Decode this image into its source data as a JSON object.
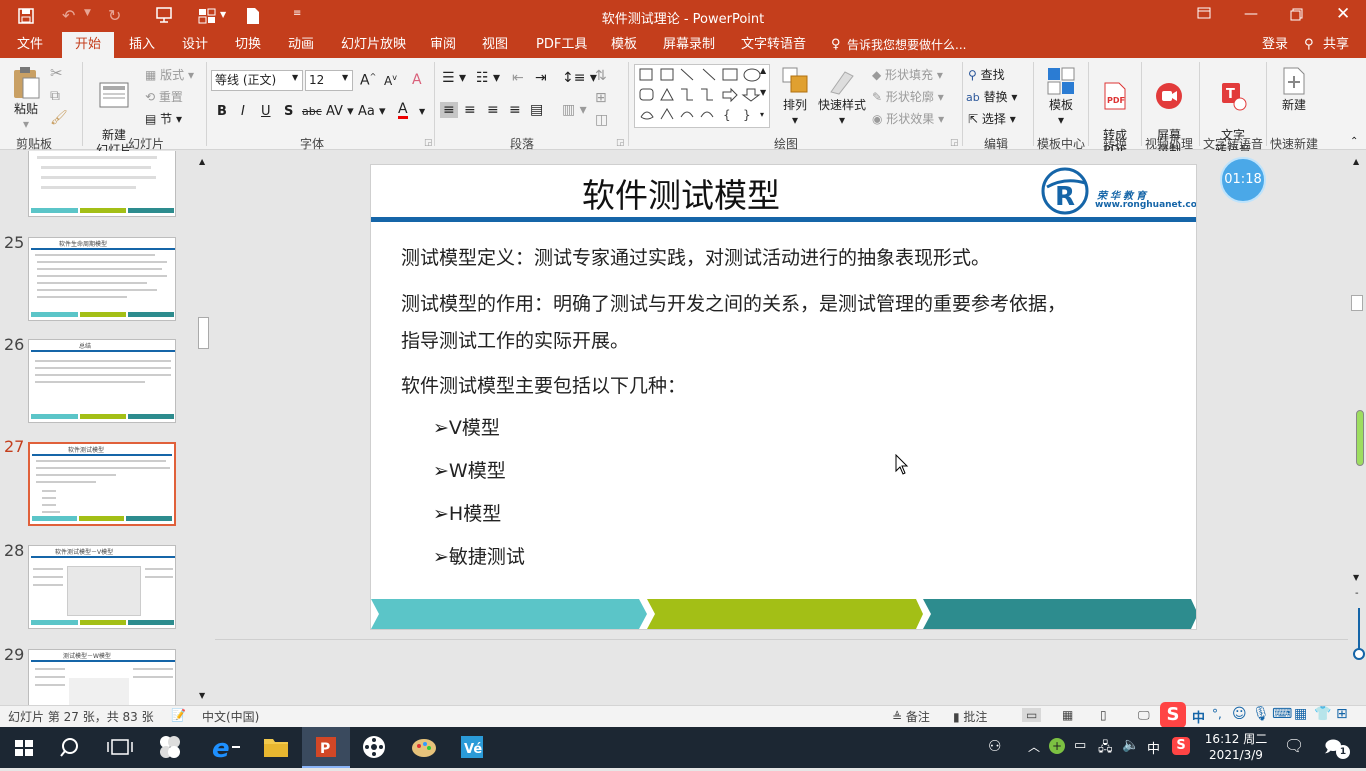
{
  "window": {
    "title": "软件测试理论 - PowerPoint"
  },
  "tabs": [
    "文件",
    "开始",
    "插入",
    "设计",
    "切换",
    "动画",
    "幻灯片放映",
    "审阅",
    "视图",
    "PDF工具",
    "模板",
    "屏幕录制",
    "文字转语音"
  ],
  "tellme": "告诉我您想要做什么...",
  "login": "登录",
  "share": "共享",
  "ribbon": {
    "clipboard": {
      "paste": "粘贴",
      "label": "剪贴板"
    },
    "slides": {
      "new_slide": "新建\n幻灯片",
      "layout": "版式",
      "reset": "重置",
      "section": "节",
      "label": "幻灯片"
    },
    "font": {
      "name": "等线 (正文)",
      "size": "12",
      "label": "字体"
    },
    "paragraph": {
      "label": "段落"
    },
    "drawing": {
      "arrange": "排列",
      "quick_styles": "快速样式",
      "shape_fill": "形状填充",
      "shape_outline": "形状轮廓",
      "shape_effects": "形状效果",
      "label": "绘图"
    },
    "editing": {
      "find": "查找",
      "replace": "替换",
      "select": "选择",
      "label": "编辑"
    },
    "template": {
      "btn": "模板",
      "label": "模板中心"
    },
    "convert": {
      "btn": "转成\nPDF",
      "label": "转换"
    },
    "video": {
      "btn": "屏幕\n录制",
      "label": "视频处理"
    },
    "tts": {
      "btn": "文字\n转语音",
      "label": "文字转语音"
    },
    "quicknew": {
      "btn": "新建",
      "label": "快速新建"
    }
  },
  "thumbnails": [
    {
      "num": "",
      "title": ""
    },
    {
      "num": "25",
      "title": "软件生命周期模型"
    },
    {
      "num": "26",
      "title": "总结"
    },
    {
      "num": "27",
      "title": "软件测试模型"
    },
    {
      "num": "28",
      "title": "软件测试模型－V模型"
    },
    {
      "num": "29",
      "title": "测试模型－W模型"
    }
  ],
  "slide": {
    "title": "软件测试模型",
    "logo_text": "荣华教育",
    "logo_url": "www.ronghuanet.com",
    "p1": "测试模型定义：测试专家通过实践，对测试活动进行的抽象表现形式。",
    "p2a": "测试模型的作用：明确了测试与开发之间的关系，是测试管理的重要参考依据，",
    "p2b": "指导测试工作的实际开展。",
    "p3": "软件测试模型主要包括以下几种：",
    "bullets": [
      "V模型",
      "W模型",
      "H模型",
      "敏捷测试"
    ],
    "timer": "01:18",
    "colors": {
      "teal": "#5bc5c8",
      "green": "#a3bf16",
      "dark_teal": "#2d8c8e",
      "blue": "#1565a8"
    }
  },
  "status": {
    "slide_info": "幻灯片 第 27 张，共 83 张",
    "language": "中文(中国)",
    "notes": "备注",
    "comments": "批注"
  },
  "taskbar": {
    "time": "16:12 周二",
    "date": "2021/3/9",
    "ime": "中"
  }
}
